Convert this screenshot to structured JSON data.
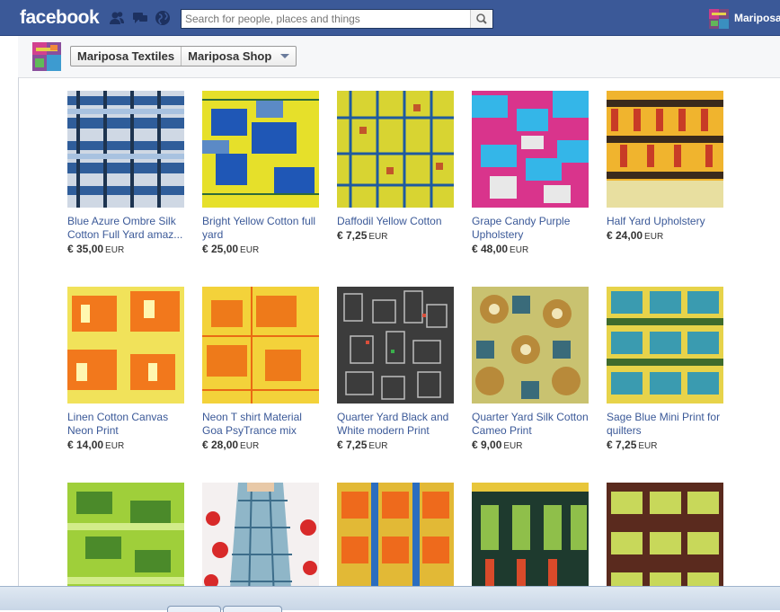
{
  "header": {
    "logo": "facebook",
    "search_placeholder": "Search for people, places and things",
    "user_name": "Mariposa",
    "icons": [
      "friend-requests-icon",
      "messages-icon",
      "notifications-globe-icon",
      "search-icon"
    ]
  },
  "subheader": {
    "page_name": "Mariposa Textiles",
    "shop_name": "Mariposa Shop"
  },
  "products": [
    {
      "title": "Blue Azure Ombre Silk Cotton Full Yard amaz...",
      "price": "€ 35,00",
      "currency": "EUR"
    },
    {
      "title": "Bright Yellow Cotton full yard",
      "price": "€ 25,00",
      "currency": "EUR"
    },
    {
      "title": "Daffodil Yellow Cotton",
      "price": "€ 7,25",
      "currency": "EUR"
    },
    {
      "title": "Grape Candy Purple Upholstery",
      "price": "€ 48,00",
      "currency": "EUR"
    },
    {
      "title": "Half Yard Upholstery",
      "price": "€ 24,00",
      "currency": "EUR"
    },
    {
      "title": "Linen Cotton Canvas Neon Print",
      "price": "€ 14,00",
      "currency": "EUR"
    },
    {
      "title": "Neon T shirt Material Goa PsyTrance mix",
      "price": "€ 28,00",
      "currency": "EUR"
    },
    {
      "title": "Quarter Yard Black and White modern Print",
      "price": "€ 7,25",
      "currency": "EUR"
    },
    {
      "title": "Quarter Yard Silk Cotton Cameo Print",
      "price": "€ 9,00",
      "currency": "EUR"
    },
    {
      "title": "Sage Blue Mini Print for quilters",
      "price": "€ 7,25",
      "currency": "EUR"
    },
    {
      "title": "",
      "price": "",
      "currency": ""
    },
    {
      "title": "",
      "price": "",
      "currency": ""
    },
    {
      "title": "",
      "price": "",
      "currency": ""
    },
    {
      "title": "",
      "price": "",
      "currency": ""
    },
    {
      "title": "",
      "price": "",
      "currency": ""
    }
  ],
  "colors": {
    "brand_blue": "#3b5998",
    "link_blue": "#3b5998"
  }
}
